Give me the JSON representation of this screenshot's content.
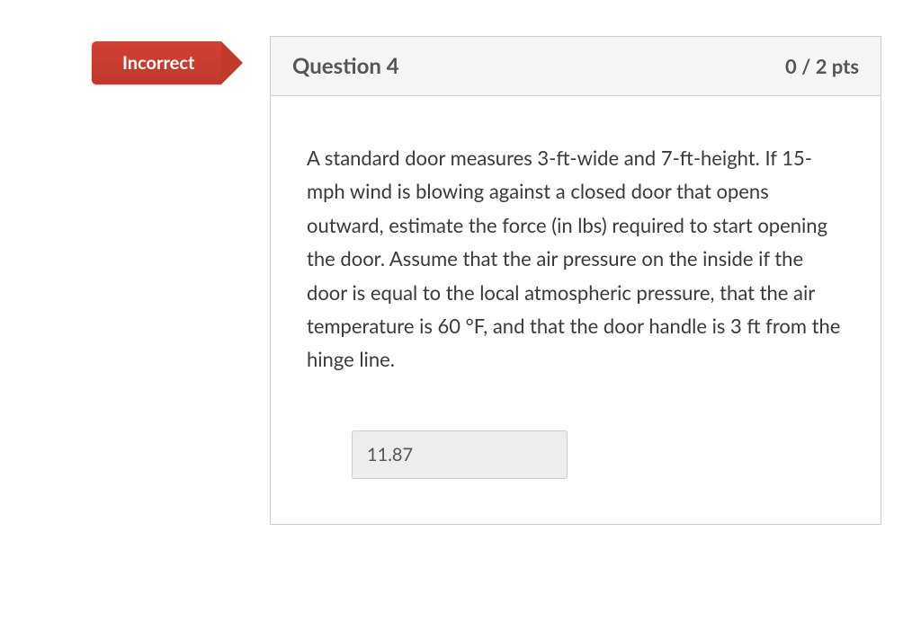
{
  "status": {
    "label": "Incorrect"
  },
  "question": {
    "title": "Question 4",
    "points": "0 / 2 pts",
    "text": "A standard door measures 3-ft-wide and 7-ft-height. If 15-mph wind is blowing against a closed door that opens outward, estimate the force (in lbs) required to start opening the door. Assume that the air pressure on the inside if the door is equal to the local atmospheric pressure, that the air temperature is 60 °F, and that the door handle is 3 ft from the hinge line.",
    "submitted_answer": "11.87"
  }
}
